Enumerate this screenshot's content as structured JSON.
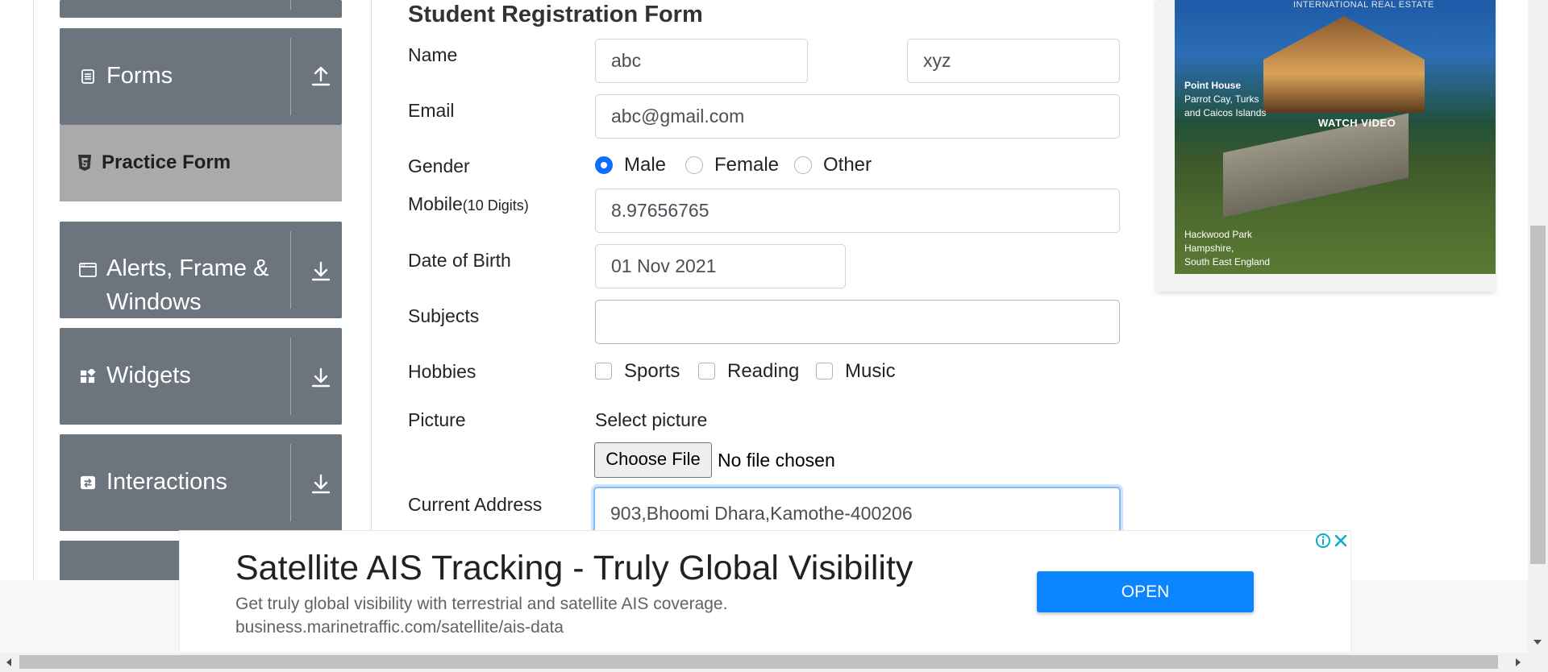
{
  "sidebar": {
    "forms_label": "Forms",
    "practice_form_label": "Practice Form",
    "alerts_label_line1": "Alerts, Frame &",
    "alerts_label_line2": "Windows",
    "widgets_label": "Widgets",
    "interactions_label": "Interactions"
  },
  "form": {
    "title": "Student Registration Form",
    "name_label": "Name",
    "first_name_value": "abc",
    "last_name_value": "xyz",
    "email_label": "Email",
    "email_value": "abc@gmail.com",
    "gender_label": "Gender",
    "gender_options": [
      "Male",
      "Female",
      "Other"
    ],
    "gender_selected": "Male",
    "mobile_label": "Mobile",
    "mobile_hint": "(10 Digits)",
    "mobile_value": "8.97656765",
    "dob_label": "Date of Birth",
    "dob_value": "01 Nov 2021",
    "subjects_label": "Subjects",
    "subjects_value": "",
    "hobbies_label": "Hobbies",
    "hobbies_options": [
      "Sports",
      "Reading",
      "Music"
    ],
    "picture_label": "Picture",
    "select_picture_label": "Select picture",
    "choose_file_label": "Choose File",
    "no_file_text": "No file chosen",
    "address_label": "Current Address",
    "address_value": "903,Bhoomi Dhara,Kamothe-400206"
  },
  "side_ad": {
    "brand_text": "INTERNATIONAL REAL ESTATE",
    "property1_title": "Point House",
    "property1_line1": "Parrot Cay, Turks",
    "property1_line2": "and Caicos Islands",
    "watch_video": "WATCH VIDEO",
    "property2_line1": "Hackwood Park",
    "property2_line2": "Hampshire,",
    "property2_line3": "South East England"
  },
  "banner_ad": {
    "title": "Satellite AIS Tracking - Truly Global Visibility",
    "description": "Get truly global visibility with terrestrial and satellite AIS coverage.",
    "url": "business.marinetraffic.com/satellite/ais-data",
    "open_label": "OPEN"
  },
  "colors": {
    "sidebar_group": "#6c757d",
    "sidebar_active": "#aaaaaa",
    "primary": "#0d6efd",
    "ad_button": "#0a84ff"
  },
  "icons": {
    "forms": "form-icon",
    "practice": "html5-icon",
    "alerts": "window-icon",
    "widgets": "widgets-icon",
    "interactions": "interactions-icon",
    "expand": "download-arrow-icon",
    "collapse": "upload-arrow-icon"
  }
}
